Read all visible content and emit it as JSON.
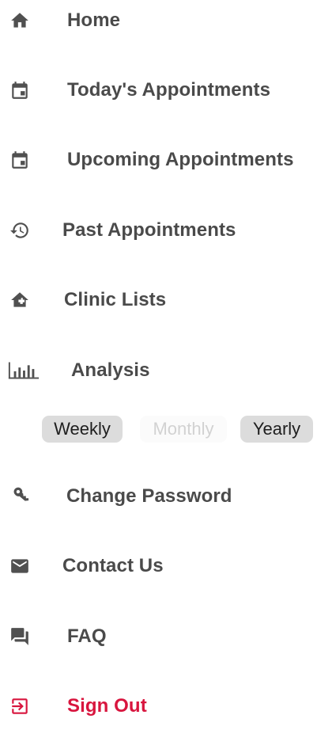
{
  "menu": {
    "items": [
      {
        "label": "Home",
        "icon": "home-icon"
      },
      {
        "label": "Today's Appointments",
        "icon": "calendar-today-icon"
      },
      {
        "label": "Upcoming Appointments",
        "icon": "calendar-upcoming-icon"
      },
      {
        "label": "Past Appointments",
        "icon": "history-icon"
      },
      {
        "label": "Clinic Lists",
        "icon": "clinic-icon"
      },
      {
        "label": "Analysis",
        "icon": "bar-chart-icon"
      }
    ],
    "analysis_periods": [
      {
        "label": "Weekly",
        "state": "selected"
      },
      {
        "label": "Monthly",
        "state": "disabled"
      },
      {
        "label": "Yearly",
        "state": "selected"
      }
    ],
    "bottom_items": [
      {
        "label": "Change Password",
        "icon": "key-icon"
      },
      {
        "label": "Contact Us",
        "icon": "mail-icon"
      },
      {
        "label": "FAQ",
        "icon": "chat-icon"
      }
    ],
    "sign_out": {
      "label": "Sign Out",
      "icon": "logout-icon"
    }
  },
  "colors": {
    "text": "#4a4a4a",
    "icon": "#505050",
    "danger": "#d8153e",
    "pill_bg": "#dcdcdc",
    "pill_disabled_text": "#d2d2d2"
  }
}
